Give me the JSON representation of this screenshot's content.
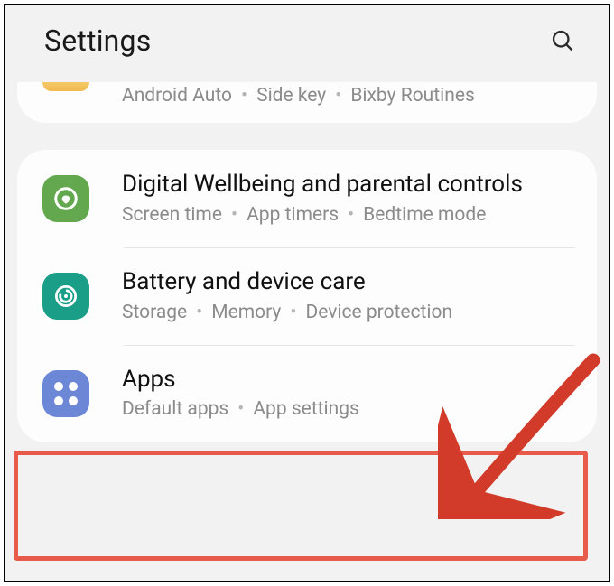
{
  "header": {
    "title": "Settings"
  },
  "partial_row": {
    "sub": [
      "Android Auto",
      "Side key",
      "Bixby Routines"
    ]
  },
  "rows": [
    {
      "id": "wellbeing",
      "title": "Digital Wellbeing and parental controls",
      "sub": [
        "Screen time",
        "App timers",
        "Bedtime mode"
      ]
    },
    {
      "id": "battery",
      "title": "Battery and device care",
      "sub": [
        "Storage",
        "Memory",
        "Device protection"
      ]
    },
    {
      "id": "apps",
      "title": "Apps",
      "sub": [
        "Default apps",
        "App settings"
      ]
    }
  ]
}
